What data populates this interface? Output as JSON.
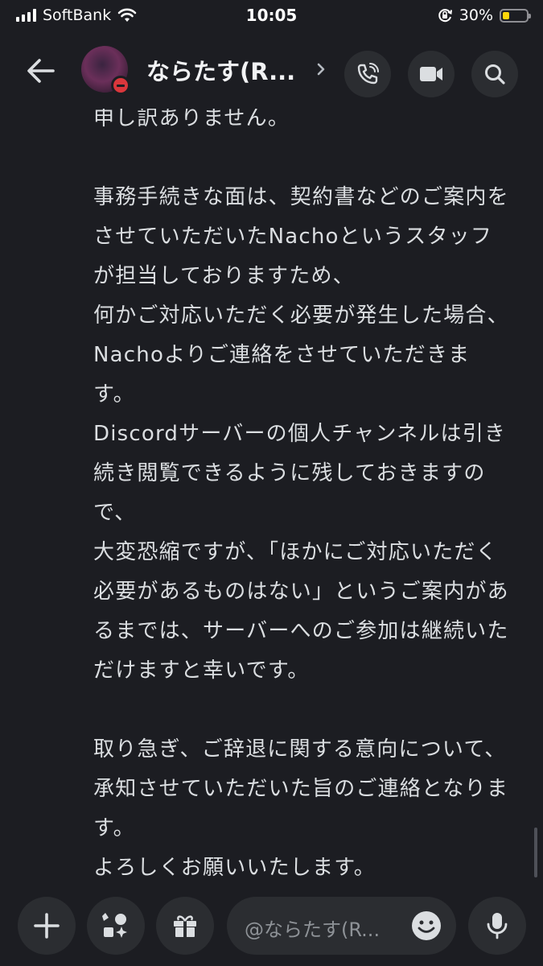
{
  "status_bar": {
    "carrier": "SoftBank",
    "time": "10:05",
    "battery_percent": "30%",
    "battery_level": 0.3,
    "icons": [
      "signal-icon",
      "wifi-icon",
      "rotation-lock-icon",
      "battery-icon"
    ]
  },
  "header": {
    "title": "ならたす(R...",
    "status": "do-not-disturb",
    "icons": [
      "back-arrow-icon",
      "avatar",
      "chevron-right-icon",
      "voice-call-icon",
      "video-call-icon",
      "search-icon"
    ]
  },
  "message": {
    "text": "申し訳ありません。\n\n事務手続きな面は、契約書などのご案内をさせていただいたNachoというスタッフが担当しておりますため、\n何かご対応いただく必要が発生した場合、Nachoよりご連絡をさせていただきます。\nDiscordサーバーの個人チャンネルは引き続き閲覧できるように残しておきますので、\n大変恐縮ですが、「ほかにご対応いただく必要があるものはない」というご案内があるまでは、サーバーへのご参加は継続いただけますと幸いです。\n\n取り急ぎ、ご辞退に関する意向について、承知させていただいた旨のご連絡となります。\nよろしくお願いいたします。"
  },
  "composer": {
    "placeholder": "@ならたす(R...",
    "icons": [
      "plus-icon",
      "apps-icon",
      "gift-icon",
      "emoji-icon",
      "microphone-icon"
    ]
  },
  "colors": {
    "background": "#1c1d22",
    "button_bg": "#2b2d31",
    "text": "#dbdee1",
    "dnd_red": "#da373c",
    "battery_yellow": "#ffd60a"
  }
}
